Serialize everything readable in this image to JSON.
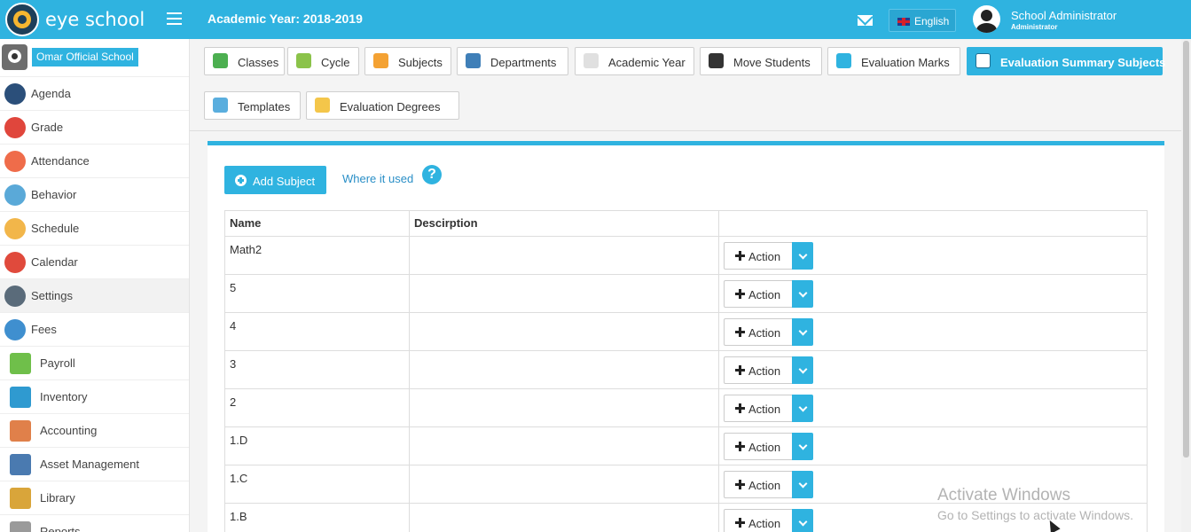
{
  "header": {
    "brand": "eye school",
    "academic_year": "Academic Year: 2018-2019",
    "language": "English",
    "user_name": "School Administrator",
    "user_role": "Administrator"
  },
  "sidebar": {
    "school_name": "Omar Official School",
    "items": [
      {
        "label": "Agenda",
        "icon": "agenda-icon",
        "color": "#2b4f7a"
      },
      {
        "label": "Grade",
        "icon": "grade-icon",
        "color": "#e0463c"
      },
      {
        "label": "Attendance",
        "icon": "attendance-icon",
        "color": "#ef6c4a"
      },
      {
        "label": "Behavior",
        "icon": "behavior-icon",
        "color": "#5aa9d8"
      },
      {
        "label": "Schedule",
        "icon": "schedule-icon",
        "color": "#f2b64a"
      },
      {
        "label": "Calendar",
        "icon": "calendar-icon",
        "color": "#e04a3c"
      },
      {
        "label": "Settings",
        "icon": "settings-icon",
        "color": "#5a6b7a"
      },
      {
        "label": "Fees",
        "icon": "fees-icon",
        "color": "#3f8fcf"
      },
      {
        "label": "Payroll",
        "icon": "payroll-icon",
        "color": "#6fbf4a"
      },
      {
        "label": "Inventory",
        "icon": "inventory-icon",
        "color": "#2f9ad0"
      },
      {
        "label": "Accounting",
        "icon": "accounting-icon",
        "color": "#e0804a"
      },
      {
        "label": "Asset Management",
        "icon": "asset-management-icon",
        "color": "#4a7ab0"
      },
      {
        "label": "Library",
        "icon": "library-icon",
        "color": "#d9a53a"
      },
      {
        "label": "Reports",
        "icon": "reports-icon",
        "color": "#9a9a9a"
      }
    ],
    "active_item": "Settings"
  },
  "tabs": [
    {
      "label": "Classes",
      "icon": "classes-icon",
      "color": "#4caf50"
    },
    {
      "label": "Cycle",
      "icon": "cycle-icon",
      "color": "#8bc34a"
    },
    {
      "label": "Subjects",
      "icon": "subjects-icon",
      "color": "#f4a233"
    },
    {
      "label": "Departments",
      "icon": "departments-icon",
      "color": "#3f7fb8"
    },
    {
      "label": "Academic Year",
      "icon": "academic-year-icon",
      "color": "#e0e0e0"
    },
    {
      "label": "Move Students",
      "icon": "move-students-icon",
      "color": "#333333"
    },
    {
      "label": "Evaluation Marks",
      "icon": "evaluation-marks-icon",
      "color": "#2fb3e0"
    },
    {
      "label": "Evaluation Summary Subjects",
      "icon": "evaluation-summary-icon",
      "color": "#ffffff"
    },
    {
      "label": "Templates",
      "icon": "templates-icon",
      "color": "#5aaede"
    },
    {
      "label": "Evaluation Degrees",
      "icon": "evaluation-degrees-icon",
      "color": "#f4c64a"
    }
  ],
  "active_tab": "Evaluation Summary Subjects",
  "main": {
    "add_button": "Add Subject",
    "where_link": "Where it used",
    "help_glyph": "?",
    "table": {
      "columns": [
        "Name",
        "Descirption",
        ""
      ],
      "rows": [
        {
          "name": "Math2",
          "description": "",
          "action": "Action"
        },
        {
          "name": "5",
          "description": "",
          "action": "Action"
        },
        {
          "name": "4",
          "description": "",
          "action": "Action"
        },
        {
          "name": "3",
          "description": "",
          "action": "Action"
        },
        {
          "name": "2",
          "description": "",
          "action": "Action"
        },
        {
          "name": "1.D",
          "description": "",
          "action": "Action"
        },
        {
          "name": "1.C",
          "description": "",
          "action": "Action"
        },
        {
          "name": "1.B",
          "description": "",
          "action": "Action"
        }
      ]
    }
  },
  "watermark": {
    "title": "Activate Windows",
    "subtitle": "Go to Settings to activate Windows."
  },
  "colors": {
    "accent": "#2fb3e0",
    "link": "#2a8fc7"
  }
}
